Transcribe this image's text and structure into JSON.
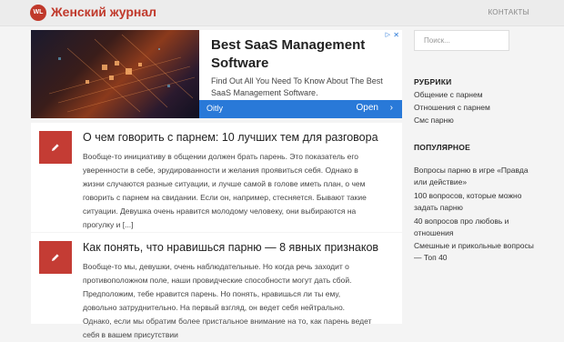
{
  "header": {
    "logo_text": "WL",
    "site_title": "Женский журнал",
    "nav_contacts": "КОНТАКТЫ"
  },
  "ad": {
    "title": "Best SaaS Management Software",
    "description": "Find Out All You Need To Know About The Best SaaS Management Software.",
    "brand": "Oitly",
    "cta": "Open",
    "cta_icon": "chevron-right-icon",
    "close_icon": "close-icon",
    "info_icon": "info-icon"
  },
  "posts": [
    {
      "icon": "pencil-icon",
      "title": "О чем говорить с парнем: 10 лучших тем для разговора",
      "excerpt": "Вообще-то инициативу в общении должен брать парень. Это показатель его уверенности в себе, эрудированности и желания проявиться себя. Однако в жизни случаются разные ситуации, и лучше самой в голове иметь план, о чем говорить с парнем на свидании. Если он, например, стесняется. Бывают такие ситуации. Девушка очень нравится молодому человеку, они выбираются на прогулку и [...]"
    },
    {
      "icon": "pencil-icon",
      "title": "Как понять, что нравишься парню — 8 явных признаков",
      "excerpt": "Вообще-то мы, девушки, очень наблюдательные. Но когда речь заходит о противоположном поле, наши провидческие способности могут дать сбой. Предположим, тебе нравится парень. Но понять, нравишься ли ты ему, довольно затруднительно. На первый взгляд, он ведет себя нейтрально. Однако, если мы обратим более пристальное внимание на то, как парень ведет себя в вашем присутствии"
    }
  ],
  "sidebar": {
    "search_placeholder": "Поиск...",
    "rubrics_title": "РУБРИКИ",
    "rubrics": [
      "Общение с парнем",
      "Отношения с парнем",
      "Смс парню"
    ],
    "popular_title": "ПОПУЛЯРНОЕ",
    "popular": [
      "Вопросы парню в игре «Правда или действие»",
      "100 вопросов, которые можно задать парню",
      "40 вопросов про любовь и отношения",
      "Смешные и прикольные вопросы — Топ 40"
    ]
  },
  "colors": {
    "accent": "#c43c34",
    "ad_bar": "#2979d8",
    "background": "#f4f4f4"
  }
}
